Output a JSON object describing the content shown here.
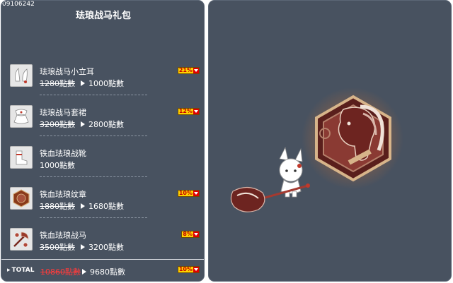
{
  "header": {
    "item_code": "09106242",
    "title": "珐琅战马礼包"
  },
  "items": [
    {
      "name": "珐琅战马小立耳",
      "old_price": "1280點數",
      "new_price": "1000點數",
      "discount": "21%",
      "icon": "horse-ears-icon"
    },
    {
      "name": "珐琅战马套裙",
      "old_price": "3200點數",
      "new_price": "2800點數",
      "discount": "12%",
      "icon": "dress-icon"
    },
    {
      "name": "铁血珐琅战靴",
      "old_price": "",
      "new_price": "1000點數",
      "discount": "",
      "icon": "boots-icon"
    },
    {
      "name": "铁血珐琅纹章",
      "old_price": "1880點數",
      "new_price": "1680點數",
      "discount": "10%",
      "icon": "emblem-icon"
    },
    {
      "name": "铁血珐琅战马",
      "old_price": "3500點數",
      "new_price": "3200點數",
      "discount": "8%",
      "icon": "warhorse-weapon-icon"
    }
  ],
  "total": {
    "label": "TOTAL",
    "old_price": "10860點數",
    "new_price": "9680點數",
    "discount": "10%"
  },
  "colors": {
    "panel_bg": "#485260",
    "badge_bg": "#ffd200",
    "badge_arrow": "#e00000",
    "total_old_price": "#ff3b3b"
  }
}
